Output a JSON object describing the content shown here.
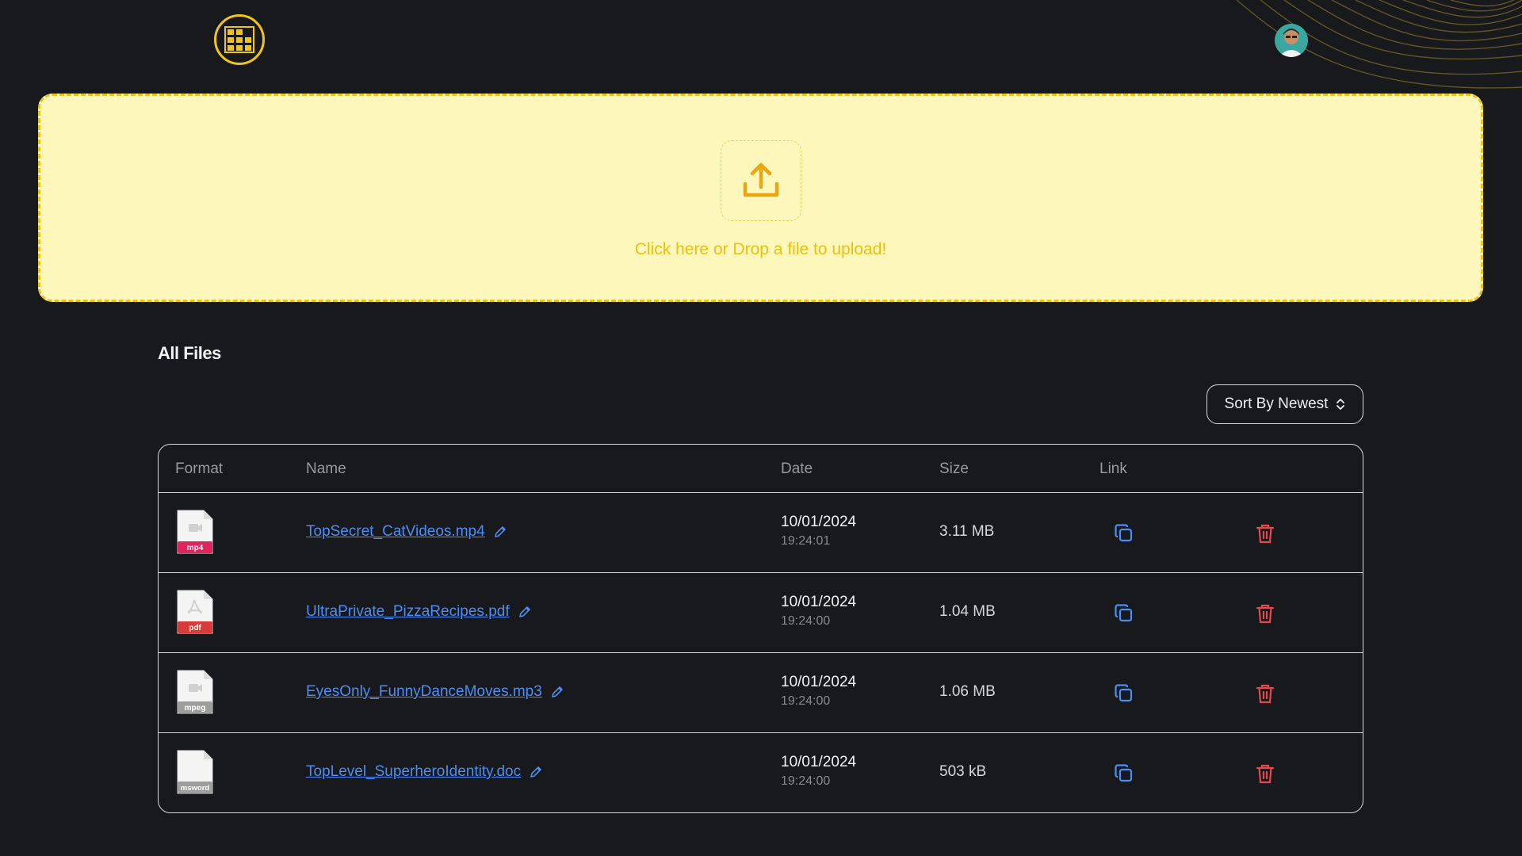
{
  "header": {
    "logo_icon": "building-logo-icon",
    "avatar_icon": "user-avatar-icon"
  },
  "upload": {
    "icon": "upload-arrow-icon",
    "text": "Click here or Drop a file to upload!"
  },
  "files_section": {
    "title": "All Files",
    "sort_label": "Sort By Newest",
    "sort_icon": "chevron-up-down-icon"
  },
  "table": {
    "columns": [
      "Format",
      "Name",
      "Date",
      "Size",
      "Link"
    ],
    "rows": [
      {
        "format": "mp4",
        "name": "TopSecret_CatVideos.mp4",
        "date": "10/01/2024",
        "time": "19:24:01",
        "size": "3.11 MB"
      },
      {
        "format": "pdf",
        "name": "UltraPrivate_PizzaRecipes.pdf",
        "date": "10/01/2024",
        "time": "19:24:00",
        "size": "1.04 MB"
      },
      {
        "format": "mpeg",
        "name": "EyesOnly_FunnyDanceMoves.mp3",
        "date": "10/01/2024",
        "time": "19:24:00",
        "size": "1.06 MB"
      },
      {
        "format": "msword",
        "name": "TopLevel_SuperheroIdentity.doc",
        "date": "10/01/2024",
        "time": "19:24:00",
        "size": "503 kB"
      }
    ]
  },
  "colors": {
    "background": "#17191c",
    "accent_yellow": "#f0c419",
    "dropzone_bg": "#fef7bb",
    "link_blue": "#4d8df5",
    "delete_red": "#e5484d",
    "mp4_badge": "#e0245e",
    "pdf_badge": "#d93a3a",
    "mpeg_badge": "#9e9e9e",
    "msword_badge": "#9e9e9e"
  }
}
